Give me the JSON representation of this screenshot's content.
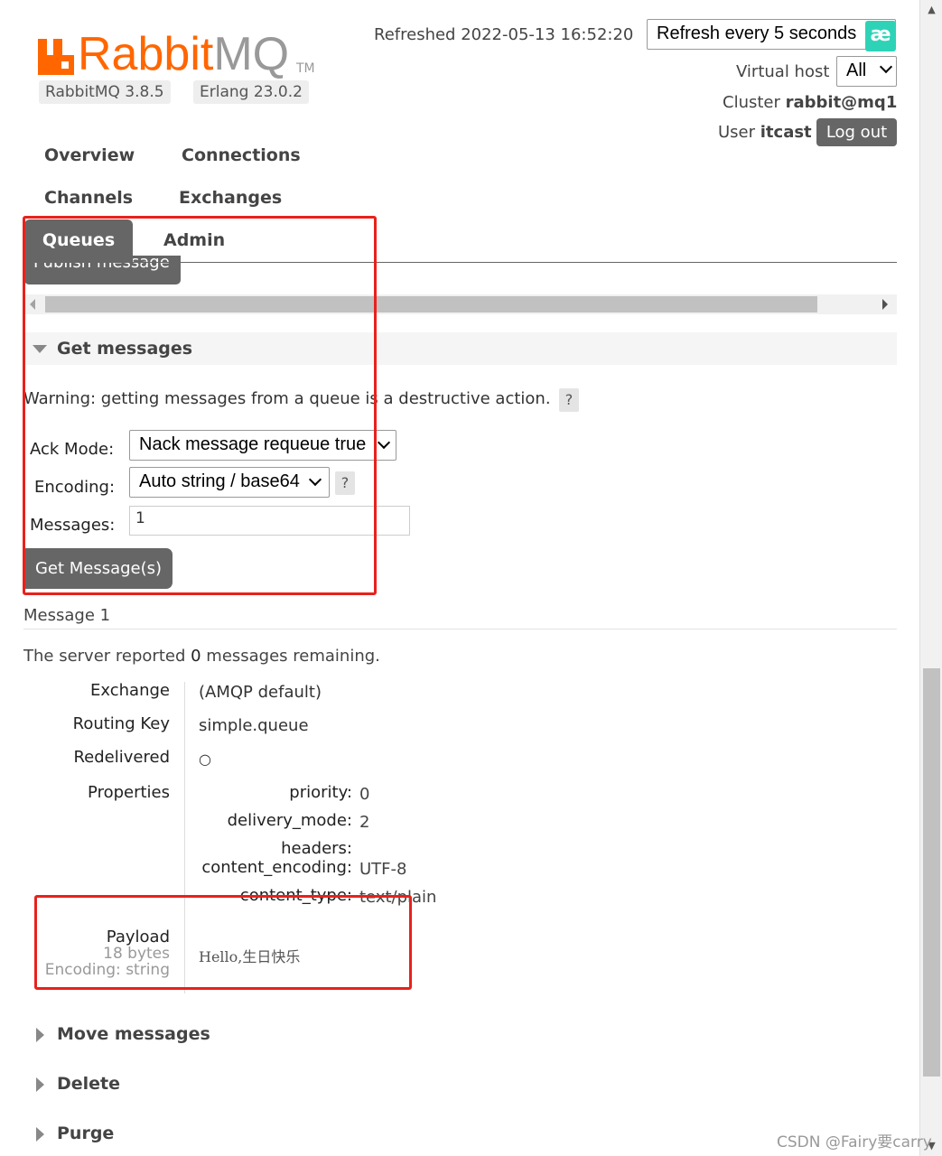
{
  "header": {
    "logo_rabbit": "Rabbit",
    "logo_mq": "MQ",
    "logo_tm": "TM",
    "rabbitmq_version": "RabbitMQ 3.8.5",
    "erlang_version": "Erlang 23.0.2",
    "refreshed": "Refreshed 2022-05-13 16:52:20",
    "refresh_option": "Refresh every 5 seconds",
    "ext_icon": "æ",
    "vhost_label": "Virtual host",
    "vhost_value": "All",
    "cluster_label": "Cluster ",
    "cluster_value": "rabbit@mq1",
    "user_label": "User ",
    "user_value": "itcast",
    "logout_label": "Log out"
  },
  "nav": {
    "overview": "Overview",
    "connections": "Connections",
    "channels": "Channels",
    "exchanges": "Exchanges",
    "queues": "Queues",
    "admin": "Admin",
    "active": "Queues"
  },
  "publish": {
    "label": "Publish message"
  },
  "get_messages": {
    "title": "Get messages",
    "warning": "Warning: getting messages from a queue is a destructive action.",
    "help": "?",
    "ack_mode_label": "Ack Mode:",
    "ack_mode_value": "Nack message requeue true",
    "encoding_label": "Encoding:",
    "encoding_value": "Auto string / base64",
    "messages_label": "Messages:",
    "messages_value": "1",
    "button": "Get Message(s)"
  },
  "message": {
    "title": "Message 1",
    "server_prefix": "The server reported ",
    "server_count": "0",
    "server_suffix": " messages remaining.",
    "fields": {
      "exchange_key": "Exchange",
      "exchange_val": "(AMQP default)",
      "routing_key_key": "Routing Key",
      "routing_key_val": "simple.queue",
      "redelivered_key": "Redelivered",
      "redelivered_val": "○",
      "properties_key": "Properties",
      "payload_key": "Payload",
      "payload_bytes": "18 bytes",
      "payload_encoding": "Encoding: string",
      "payload_val": "Hello,生日快乐"
    },
    "properties": [
      {
        "key": "priority:",
        "value": "0"
      },
      {
        "key": "delivery_mode:",
        "value": "2"
      },
      {
        "key": "headers:",
        "value": ""
      },
      {
        "key": "content_encoding:",
        "value": "UTF-8"
      },
      {
        "key": "content_type:",
        "value": "text/plain"
      }
    ]
  },
  "sections": {
    "move": "Move messages",
    "delete": "Delete",
    "purge": "Purge"
  },
  "watermark": "CSDN @Fairy要carry",
  "colors": {
    "brand_orange": "#ff6600",
    "tab_active": "#666666",
    "annotation_red": "#e8211b",
    "ext_icon": "#2ed3b7"
  }
}
